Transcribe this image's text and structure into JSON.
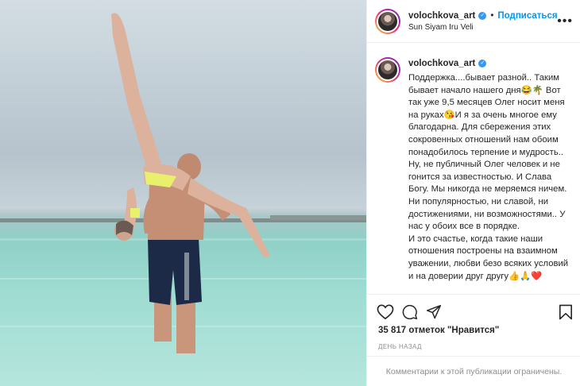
{
  "post": {
    "username": "volochkova_art",
    "follow_label": "Подписаться",
    "location": "Sun Siyam Iru Veli",
    "caption_paragraphs": [
      "Поддержка....бывает разной.. Таким бывает начало нашего дня😂🌴 Вот так уже 9,5 месяцев Олег носит меня на руках😘И я за очень многое ему благодарна. Для сбережения этих сокровенных отношений нам обоим понадобилось терпение и мудрость.. Ну, не публичный Олег человек и не гонится за известностью. И Слава Богу. Мы никогда не меряемся ничем. Ни популярностью, ни славой, ни достижениями, ни возможностями.. У нас у обоих все в порядке.",
      "И это счастье, когда такие наши отношения построены на взаимном уважении, любви безо всяких условий и на доверии друг другу👍🙏❤️"
    ],
    "likes_text": "35 817 отметок \"Нравится\"",
    "time_text": "ДЕНЬ НАЗАД",
    "comments_disabled_text": "Комментарии к этой публикации ограничены."
  },
  "icons": {
    "verified": "verified-badge-icon",
    "more": "more-options-icon",
    "like": "heart-outline-icon",
    "comment": "comment-bubble-icon",
    "share": "paper-plane-icon",
    "save": "bookmark-icon"
  },
  "colors": {
    "accent_blue": "#0095f6",
    "verified_blue": "#3897f0",
    "text": "#262626",
    "muted": "#8e8e8e",
    "divider": "#efefef"
  }
}
